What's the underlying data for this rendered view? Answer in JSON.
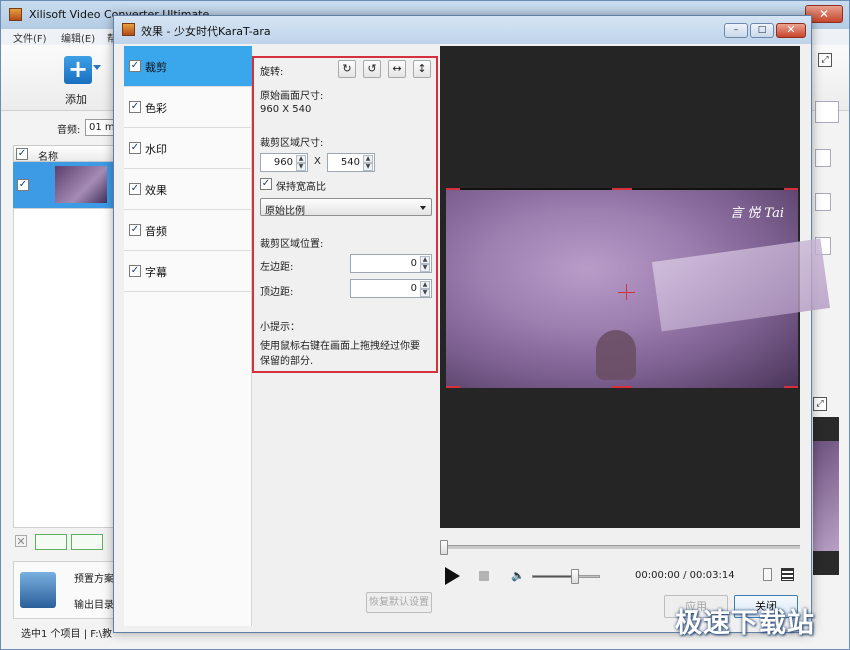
{
  "main_window": {
    "title": "Xilisoft Video Converter Ultimate",
    "close_label": "✕",
    "menu": [
      "文件(F)",
      "编辑(E)",
      "帮"
    ],
    "toolbar": {
      "add_label": "添加"
    },
    "audio_label": "音频:",
    "audio_value": "01 m",
    "list_header": "名称",
    "preset_label": "预置方案",
    "output_label": "输出目录",
    "status_text": "选中1 个项目 | F:\\教"
  },
  "dialog": {
    "title": "效果 - 少女时代KaraT-ara",
    "window_buttons": {
      "minimize": "–",
      "maximize": "□",
      "close": "✕"
    },
    "nav": [
      {
        "label": "裁剪",
        "checked": true,
        "active": true
      },
      {
        "label": "色彩",
        "checked": true,
        "active": false
      },
      {
        "label": "水印",
        "checked": true,
        "active": false
      },
      {
        "label": "效果",
        "checked": true,
        "active": false
      },
      {
        "label": "音频",
        "checked": true,
        "active": false
      },
      {
        "label": "字幕",
        "checked": true,
        "active": false
      }
    ],
    "crop": {
      "rotate_label": "旋转:",
      "rotate_buttons": [
        "↻",
        "↺",
        "↔",
        "↕"
      ],
      "original_size_label": "原始画面尺寸:",
      "original_size_value": "960 X 540",
      "crop_size_label": "裁剪区域尺寸:",
      "crop_width": "960",
      "crop_x": "X",
      "crop_height": "540",
      "keep_ratio_label": "保持宽高比",
      "keep_ratio_checked": true,
      "ratio_select_value": "原始比例",
      "crop_position_label": "裁剪区域位置:",
      "left_margin_label": "左边距:",
      "left_margin_value": "0",
      "top_margin_label": "顶边距:",
      "top_margin_value": "0",
      "tip_title": "小提示：",
      "tip_line1": "使用鼠标右键在画面上拖拽经过你要",
      "tip_line2": "保留的部分."
    },
    "reset_label": "恢复默认设置",
    "preview": {
      "caption": "言 悦 Tai"
    },
    "player": {
      "time": "00:00:00 / 00:03:14",
      "seek_fraction": 0,
      "volume_fraction": 0.66
    },
    "apply_label": "应用",
    "close_label": "关闭"
  },
  "watermark": "极速下载站",
  "colors": {
    "accent": "#3aa6ec",
    "highlight_border": "#d5303b",
    "preview_bg": "#252525"
  }
}
